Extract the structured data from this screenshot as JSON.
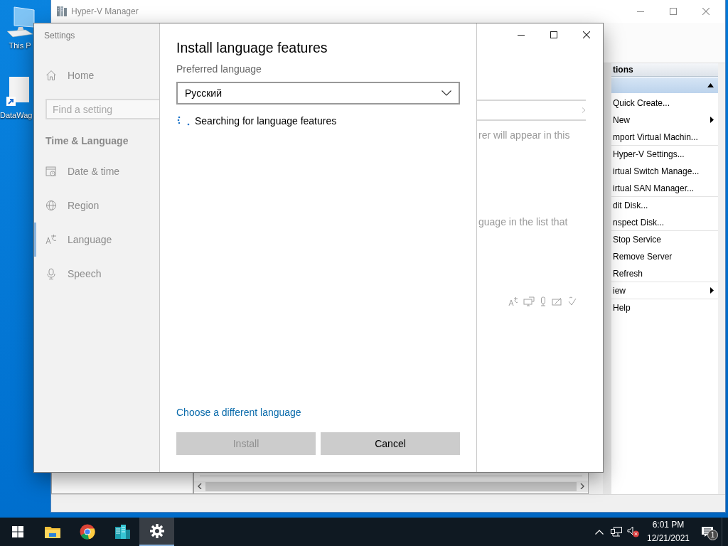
{
  "desktop_icons": [
    {
      "label": "This P",
      "kind": "computer"
    },
    {
      "label": "DataWag",
      "kind": "file"
    }
  ],
  "hyperv_window": {
    "title": "Hyper-V Manager",
    "actions": {
      "header": "tions",
      "group_expanded": true,
      "items": [
        {
          "label": "Quick Create...",
          "submenu": false,
          "separator_before": false
        },
        {
          "label": "New",
          "submenu": true,
          "separator_before": false
        },
        {
          "label": "mport Virtual Machin...",
          "submenu": false,
          "separator_before": false
        },
        {
          "label": "Hyper-V Settings...",
          "submenu": false,
          "separator_before": true
        },
        {
          "label": "irtual Switch Manage...",
          "submenu": false,
          "separator_before": false
        },
        {
          "label": "irtual SAN Manager...",
          "submenu": false,
          "separator_before": false
        },
        {
          "label": "dit Disk...",
          "submenu": false,
          "separator_before": true
        },
        {
          "label": "nspect Disk...",
          "submenu": false,
          "separator_before": false
        },
        {
          "label": "Stop Service",
          "submenu": false,
          "separator_before": true
        },
        {
          "label": "Remove Server",
          "submenu": false,
          "separator_before": false
        },
        {
          "label": "Refresh",
          "submenu": false,
          "separator_before": false
        },
        {
          "label": "iew",
          "submenu": true,
          "separator_before": true
        },
        {
          "label": "Help",
          "submenu": false,
          "separator_before": true
        }
      ]
    }
  },
  "settings_window": {
    "title": "Settings",
    "home": "Home",
    "search": {
      "placeholder": "Find a setting"
    },
    "section": "Time & Language",
    "nav_items": [
      {
        "label": "Date & time",
        "kind": "clock",
        "selected": false
      },
      {
        "label": "Region",
        "kind": "globe",
        "selected": false
      },
      {
        "label": "Language",
        "kind": "language",
        "selected": true
      },
      {
        "label": "Speech",
        "kind": "microphone",
        "selected": false
      }
    ],
    "page_texts": [
      "rer will appear in this",
      "guage in the list that"
    ]
  },
  "dialog": {
    "title": "Install language features",
    "field_label": "Preferred language",
    "dropdown": {
      "value": "Русский"
    },
    "status": "Searching for language features",
    "link": "Choose a different language",
    "buttons": [
      {
        "label": "Install",
        "disabled": true
      },
      {
        "label": "Cancel",
        "disabled": false
      }
    ]
  },
  "taskbar": {
    "buttons": [
      {
        "kind": "start",
        "selected": false
      },
      {
        "kind": "folder",
        "selected": false
      },
      {
        "kind": "browser",
        "selected": false
      },
      {
        "kind": "server",
        "selected": false
      },
      {
        "kind": "gear",
        "selected": true
      }
    ],
    "volume_muted": true,
    "time": "6:01 PM",
    "date": "12/21/2021",
    "notification_count": "1"
  }
}
